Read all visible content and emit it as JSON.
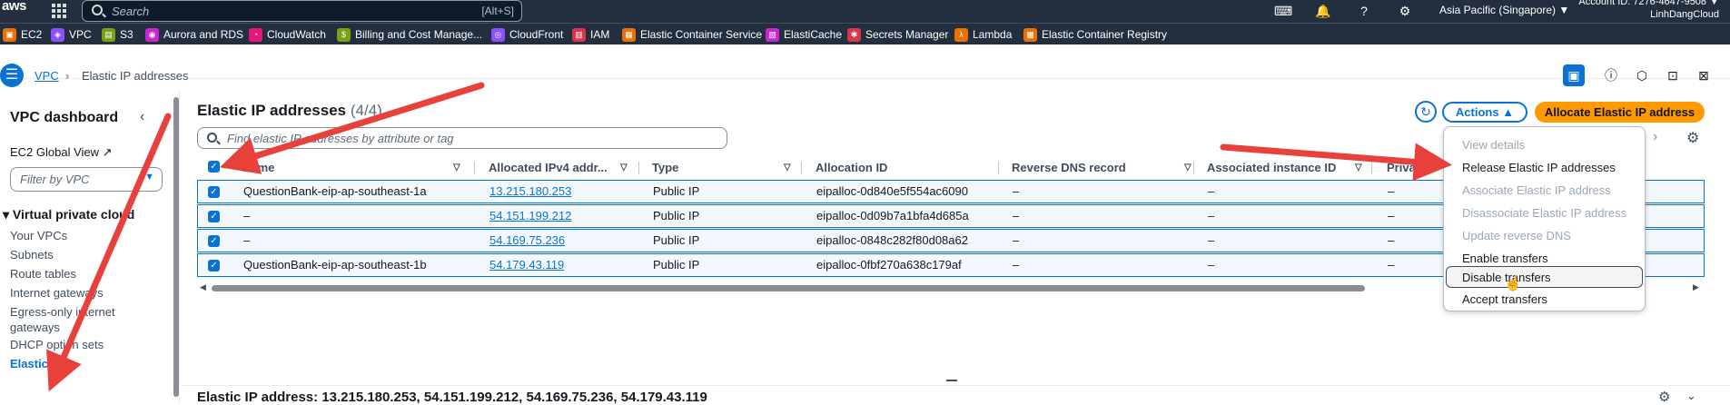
{
  "topbar": {
    "logo": "aws",
    "search_placeholder": "Search",
    "search_shortcut": "[Alt+S]",
    "region": "Asia Pacific (Singapore) ▼",
    "account_id": "Account ID: 7276-4647-9508 ▼",
    "user": "LinhDangCloud"
  },
  "favorites": [
    {
      "label": "EC2",
      "color": "#ed7100",
      "icon": "ec2-icon"
    },
    {
      "label": "VPC",
      "color": "#8c4fff",
      "icon": "vpc-icon"
    },
    {
      "label": "S3",
      "color": "#7aa116",
      "icon": "s3-icon"
    },
    {
      "label": "Aurora and RDS",
      "color": "#c925d1",
      "icon": "rds-icon"
    },
    {
      "label": "CloudWatch",
      "color": "#e7157b",
      "icon": "cloudwatch-icon"
    },
    {
      "label": "Billing and Cost Manage...",
      "color": "#7aa116",
      "icon": "billing-icon"
    },
    {
      "label": "CloudFront",
      "color": "#8c4fff",
      "icon": "cloudfront-icon"
    },
    {
      "label": "IAM",
      "color": "#dd344c",
      "icon": "iam-icon"
    },
    {
      "label": "Elastic Container Service",
      "color": "#ed7100",
      "icon": "ecs-icon"
    },
    {
      "label": "ElastiCache",
      "color": "#c925d1",
      "icon": "elasticache-icon"
    },
    {
      "label": "Secrets Manager",
      "color": "#dd344c",
      "icon": "secrets-icon"
    },
    {
      "label": "Lambda",
      "color": "#ed7100",
      "icon": "lambda-icon"
    },
    {
      "label": "Elastic Container Registry",
      "color": "#ed7100",
      "icon": "ecr-icon"
    }
  ],
  "breadcrumb": {
    "root": "VPC",
    "current": "Elastic IP addresses"
  },
  "sidebar": {
    "title": "VPC dashboard",
    "global_view": "EC2 Global View",
    "filter_placeholder": "Filter by VPC",
    "section": "Virtual private cloud",
    "items": [
      {
        "label": "Your VPCs"
      },
      {
        "label": "Subnets"
      },
      {
        "label": "Route tables"
      },
      {
        "label": "Internet gateways"
      },
      {
        "label": "Egress-only internet gateways"
      },
      {
        "label": "DHCP option sets"
      },
      {
        "label": "Elastic IPs"
      }
    ]
  },
  "main": {
    "title": "Elastic IP addresses",
    "count": "(4/4)",
    "search_placeholder": "Find elastic IP addresses by attribute or tag",
    "actions_label": "Actions ▲",
    "allocate_label": "Allocate Elastic IP address",
    "columns": [
      "Name",
      "Allocated IPv4 addr...",
      "Type",
      "Allocation ID",
      "Reverse DNS record",
      "Associated instance ID",
      "Priva"
    ],
    "rows": [
      {
        "name": "QuestionBank-eip-ap-southeast-1a",
        "ip": "13.215.180.253",
        "type": "Public IP",
        "alloc": "eipalloc-0d840e5f554ac6090",
        "rdns": "–",
        "instance": "–",
        "private": "–"
      },
      {
        "name": "–",
        "ip": "54.151.199.212",
        "type": "Public IP",
        "alloc": "eipalloc-0d09b7a1bfa4d685a",
        "rdns": "–",
        "instance": "–",
        "private": "–"
      },
      {
        "name": "–",
        "ip": "54.169.75.236",
        "type": "Public IP",
        "alloc": "eipalloc-0848c282f80d08a62",
        "rdns": "–",
        "instance": "–",
        "private": "–"
      },
      {
        "name": "QuestionBank-eip-ap-southeast-1b",
        "ip": "54.179.43.119",
        "type": "Public IP",
        "alloc": "eipalloc-0fbf270a638c179af",
        "rdns": "–",
        "instance": "–",
        "private": "–"
      }
    ]
  },
  "actions_menu": [
    {
      "label": "View details",
      "enabled": false
    },
    {
      "label": "Release Elastic IP addresses",
      "enabled": true
    },
    {
      "label": "Associate Elastic IP address",
      "enabled": false
    },
    {
      "label": "Disassociate Elastic IP address",
      "enabled": false
    },
    {
      "label": "Update reverse DNS",
      "enabled": false
    },
    {
      "label": "Enable transfers",
      "enabled": true
    },
    {
      "label": "Disable transfers",
      "enabled": true
    },
    {
      "label": "Accept transfers",
      "enabled": true
    }
  ],
  "bottom": {
    "title": "Elastic IP address: 13.215.180.253, 54.151.199.212, 54.169.75.236, 54.179.43.119"
  },
  "annotation_color": "#e8413c"
}
